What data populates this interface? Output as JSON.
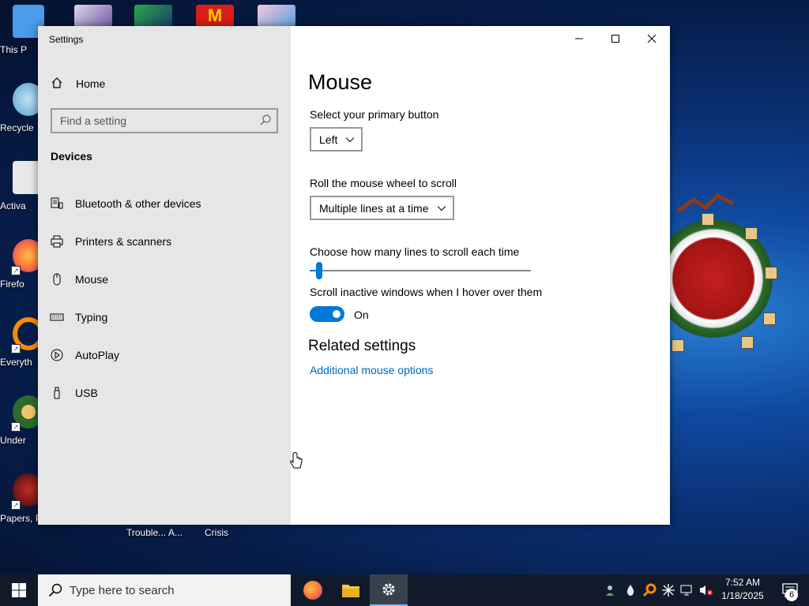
{
  "desktop": {
    "icons": [
      {
        "label": "This P",
        "color": "#4a9be8"
      },
      {
        "label": "Recycle",
        "color": "#6fb0d8"
      },
      {
        "label": "Activa",
        "color": "#e8e8e8"
      },
      {
        "label": "Firefo",
        "color": "#ff7139"
      },
      {
        "label": "Everyth",
        "color": "#ff8a00"
      },
      {
        "label": "Under",
        "color": "#2c6b2c"
      },
      {
        "label": "Papers, P",
        "color": "#8a1a1a"
      }
    ],
    "below_window_labels": [
      "Trouble... A...",
      "Crisis"
    ]
  },
  "window": {
    "title": "Settings",
    "sidebar": {
      "home_label": "Home",
      "search_placeholder": "Find a setting",
      "section_label": "Devices",
      "items": [
        {
          "label": "Bluetooth & other devices",
          "icon": "bluetooth-devices-icon"
        },
        {
          "label": "Printers & scanners",
          "icon": "printer-icon"
        },
        {
          "label": "Mouse",
          "icon": "mouse-icon"
        },
        {
          "label": "Typing",
          "icon": "keyboard-icon"
        },
        {
          "label": "AutoPlay",
          "icon": "autoplay-icon"
        },
        {
          "label": "USB",
          "icon": "usb-icon"
        }
      ]
    },
    "main": {
      "title": "Mouse",
      "primary_button_label": "Select your primary button",
      "primary_button_value": "Left",
      "scroll_label": "Roll the mouse wheel to scroll",
      "scroll_value": "Multiple lines at a time",
      "lines_label": "Choose how many lines to scroll each time",
      "lines_slider_fraction": 0.03,
      "inactive_label": "Scroll inactive windows when I hover over them",
      "inactive_state": "On",
      "related_title": "Related settings",
      "related_link": "Additional mouse options"
    }
  },
  "taskbar": {
    "search_placeholder": "Type here to search",
    "time": "7:52 AM",
    "date": "1/18/2025",
    "notification_count": "6"
  },
  "colors": {
    "accent": "#0078d7",
    "link": "#0067b8",
    "sidebar_bg": "#e6e6e6",
    "taskbar_bg": "#101a2a"
  }
}
